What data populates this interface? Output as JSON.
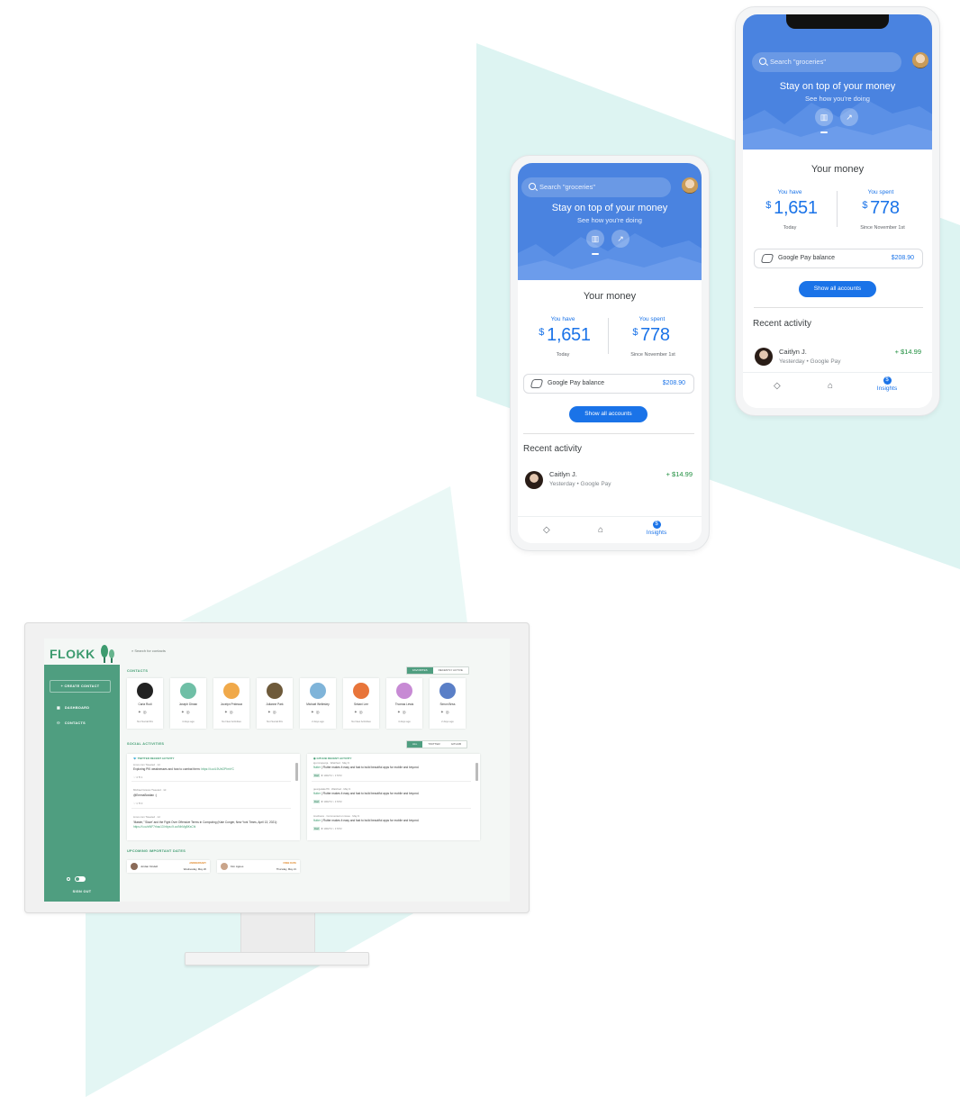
{
  "phone_back": {
    "search_placeholder": "Search \"groceries\"",
    "hero_title": "Stay on top of your money",
    "hero_subtitle": "See how you're doing",
    "money_title": "Your money",
    "you_have_label": "You have",
    "you_have_currency": "$",
    "you_have_value": "1,651",
    "you_have_sub": "Today",
    "you_spent_label": "You spent",
    "you_spent_currency": "$",
    "you_spent_value": "778",
    "you_spent_sub": "Since November 1st",
    "balance_label": "Google Pay balance",
    "balance_amount": "$208.90",
    "show_accounts": "Show all accounts",
    "recent_title": "Recent activity",
    "activity": {
      "name": "Caitlyn J.",
      "sub": "Yesterday • Google Pay",
      "amount": "+ $14.99"
    },
    "nav_insights": "Insights",
    "nav_insights_badge": "$"
  },
  "phone_front": {
    "search_placeholder": "Search \"groceries\"",
    "hero_title": "Stay on top of your money",
    "hero_subtitle": "See how you're doing",
    "money_title": "Your money",
    "you_have_label": "You have",
    "you_have_currency": "$",
    "you_have_value": "1,651",
    "you_have_sub": "Today",
    "you_spent_label": "You spent",
    "you_spent_currency": "$",
    "you_spent_value": "778",
    "you_spent_sub": "Since November 1st",
    "balance_label": "Google Pay balance",
    "balance_amount": "$208.90",
    "show_accounts": "Show all accounts",
    "recent_title": "Recent activity",
    "activity": {
      "name": "Caitlyn J.",
      "sub": "Yesterday • Google Pay",
      "amount": "+ $14.99"
    },
    "nav_insights": "Insights",
    "nav_insights_badge": "$"
  },
  "flokk": {
    "logo": "FLOKK",
    "search_placeholder": "Search for contacts",
    "create_contact": "+ CREATE CONTACT",
    "nav": [
      {
        "icon": "dashboard-icon",
        "label": "DASHBOARD"
      },
      {
        "icon": "person-icon",
        "label": "CONTACTS"
      }
    ],
    "sign_out": "SIGN OUT",
    "contacts_title": "CONTACTS",
    "contacts_tabs": [
      "FAVORITES",
      "RECENTLY ACTIVE"
    ],
    "contacts": [
      {
        "name": "Carla Rudi",
        "status": "Not Social IDs",
        "color": "#222222"
      },
      {
        "name": "Joseph Diman",
        "status": "4 days ago",
        "color": "#6fbfa6"
      },
      {
        "name": "Jocelyn Prideaux",
        "status": "No New Activities",
        "color": "#f0a94a"
      },
      {
        "name": "Julianne Park",
        "status": "Not Social IDs",
        "color": "#6e5a3a"
      },
      {
        "name": "Michael Wellesley",
        "status": "2 days ago",
        "color": "#7fb4d9"
      },
      {
        "name": "Sekani Lee",
        "status": "No New Activities",
        "color": "#e8753a"
      },
      {
        "name": "Thomas Lewis",
        "status": "4 days ago",
        "color": "#c78ad4"
      },
      {
        "name": "Simon Briss",
        "status": "2 days ago",
        "color": "#5a7fc7"
      }
    ],
    "social_title": "SOCIAL ACTIVITIES",
    "social_tabs": [
      "ALL",
      "TWITTER",
      "GITHUB"
    ],
    "twitter_header": "TWITTER RECENT ACTIVITY",
    "twitter_items": [
      {
        "meta": "Linux.com  Tweeted · 1d",
        "text": "Exploring PKI weaknesses and how to combat them: ",
        "link": "https://t.co/L9UhGPhmYC"
      },
      {
        "meta": "Michael Graves  Tweeted · 1d",
        "text": "@EmmaBostian :)",
        "link": ""
      },
      {
        "meta": "Linux.com  Tweeted · 1d",
        "text": "'Master,' 'Slave' and the Fight Over Offensive Terms in Computing (Kate Conger, New York Times, April 13, 2021): ",
        "link": "https://t.co/xWF7rhac13 https://t.co/NhMgBKsChl"
      }
    ],
    "github_header": "GITHUB RECENT ACTIVITY",
    "github_items": [
      {
        "meta": "igor-krupenja · Watched · May 9",
        "repo": "flutter",
        "text": " | Flutter makes it easy and fast to build beautiful apps for mobile and beyond.",
        "lang": "Dart",
        "stats": "★ 100274  ⑂ 17072"
      },
      {
        "meta": "georgekalel79 · Watched · May 9",
        "repo": "flutter",
        "text": " | Flutter makes it easy and fast to build beautiful apps for mobile and beyond.",
        "lang": "Dart",
        "stats": "★ 100274  ⑂ 17072"
      },
      {
        "meta": "tmethews · Commented on issue · May 9",
        "repo": "flutter",
        "text": " | Flutter makes it easy and fast to build beautiful apps for mobile and beyond.",
        "lang": "Dart",
        "stats": "★ 100274  ⑂ 17072"
      }
    ],
    "dates_title": "UPCOMING IMPORTANT DATES",
    "dates": [
      {
        "name": "Jordan Kindell",
        "type": "ANNIVERSARY",
        "date": "Wednesday, May 26"
      },
      {
        "name": "Kim Agnes",
        "type": "FREE DATE",
        "date": "Thursday, May 21"
      }
    ]
  }
}
